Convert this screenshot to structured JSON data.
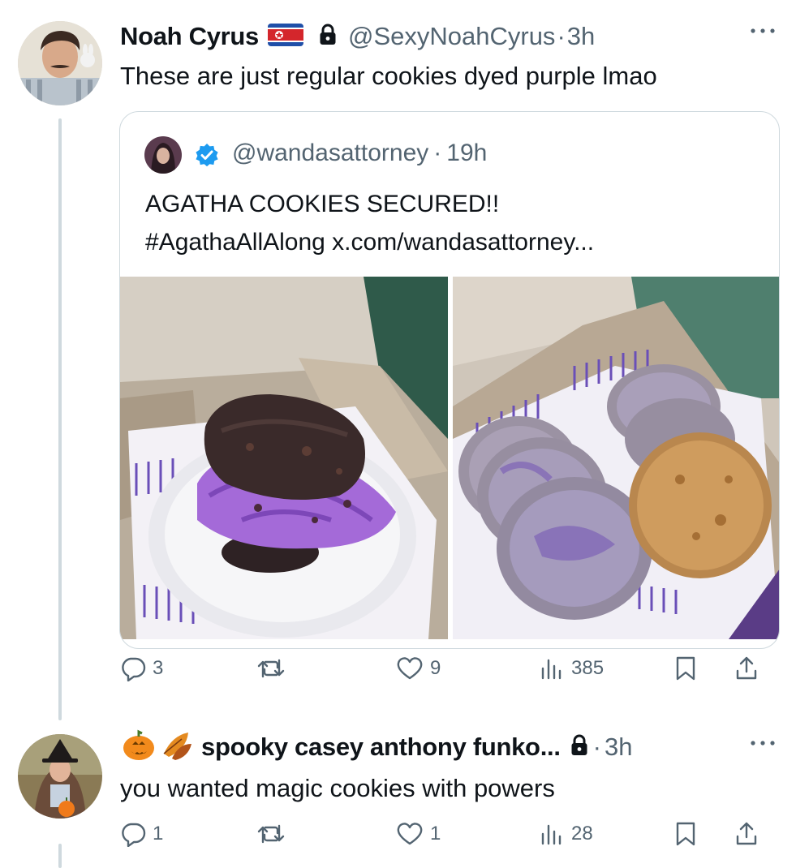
{
  "tweet1": {
    "name": "Noah Cyrus",
    "handle": "@SexyNoahCyrus",
    "separator": "·",
    "time": "3h",
    "text": "These are just regular cookies dyed purple lmao",
    "quote": {
      "handle": "@wandasattorney",
      "separator": "·",
      "time": "19h",
      "line1": "AGATHA COOKIES SECURED!!",
      "line2": "#AgathaAllAlong x.com/wandasattorney..."
    },
    "stats": {
      "replies": "3",
      "retweets": "",
      "likes": "9",
      "views": "385"
    }
  },
  "tweet2": {
    "name": "spooky casey anthony funko...",
    "separator": "·",
    "time": "3h",
    "text": "you wanted magic cookies with powers",
    "stats": {
      "replies": "1",
      "retweets": "",
      "likes": "1",
      "views": "28"
    }
  },
  "icons": {
    "flag": "north-korea-flag-icon",
    "lock": "lock-icon",
    "verified": "verified-badge-icon",
    "more": "more-icon",
    "reply": "reply-icon",
    "retweet": "retweet-icon",
    "like": "heart-icon",
    "views": "views-icon",
    "bookmark": "bookmark-icon",
    "share": "share-icon",
    "pumpkin": "pumpkin-emoji",
    "leaves": "fallen-leaf-emoji"
  },
  "colors": {
    "text": "#0f1419",
    "secondary": "#536471",
    "border": "#cfd9de",
    "verified": "#1d9bf0",
    "purple_ice_cream": "#a46ad8"
  }
}
